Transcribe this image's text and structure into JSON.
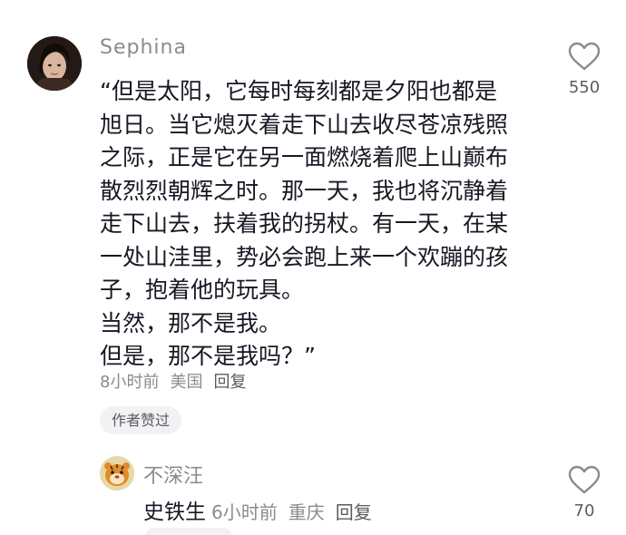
{
  "comment": {
    "username": "Sephina",
    "text_lines": [
      "“但是太阳，它每时每刻都是夕阳也都是",
      "旭日。当它熄灭着走下山去收尽苍凉残照",
      "之际，正是它在另一面燃烧着爬上山巅布",
      "散烈烈朝辉之时。那一天，我也将沉静着",
      "走下山去，扶着我的拐杖。有一天，在某",
      "一处山洼里，势必会跑上来一个欢蹦的孩",
      "子，抱着他的玩具。",
      "当然，那不是我。",
      "但是，那不是我吗？”"
    ],
    "time": "8小时前",
    "location": "美国",
    "reply_label": "回复",
    "author_liked_badge": "作者赞过",
    "like_count": "550",
    "like_icon": "heart-outline-icon"
  },
  "reply": {
    "username": "不深汪",
    "text": "史铁生",
    "time": "6小时前",
    "location": "重庆",
    "reply_label": "回复",
    "like_count": "70",
    "like_icon": "heart-outline-icon"
  },
  "colors": {
    "text_primary": "#161823",
    "text_secondary": "#8a8b91",
    "chip_bg": "#f2f2f4",
    "icon_gray": "#8a8b91"
  }
}
